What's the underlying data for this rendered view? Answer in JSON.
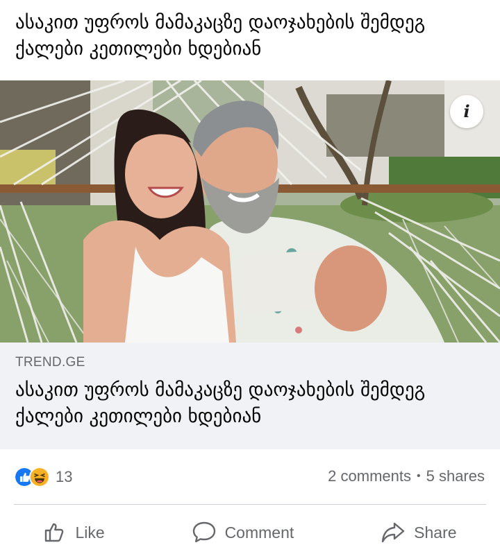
{
  "post": {
    "text": "ასაკით უფროს მამაკაცზე დაოჯახების შემდეგ ქალები კეთილები ხდებიან"
  },
  "image": {
    "info_badge": "i"
  },
  "link_preview": {
    "domain": "TREND.GE",
    "title": "ასაკით უფროს მამაკაცზე დაოჯახების შემდეგ ქალები კეთილები ხდებიან"
  },
  "engagement": {
    "reaction_icons": [
      "like-icon",
      "haha-icon"
    ],
    "reaction_count": "13",
    "comments": "2 comments",
    "separator": "•",
    "shares": "5 shares"
  },
  "actions": {
    "like": "Like",
    "comment": "Comment",
    "share": "Share"
  },
  "colors": {
    "text": "#050505",
    "secondary_text": "#65676b",
    "link_background": "#f0f2f5",
    "like_blue": "#1877f2",
    "haha_yellow": "#f7b125",
    "divider": "#ced0d4"
  }
}
